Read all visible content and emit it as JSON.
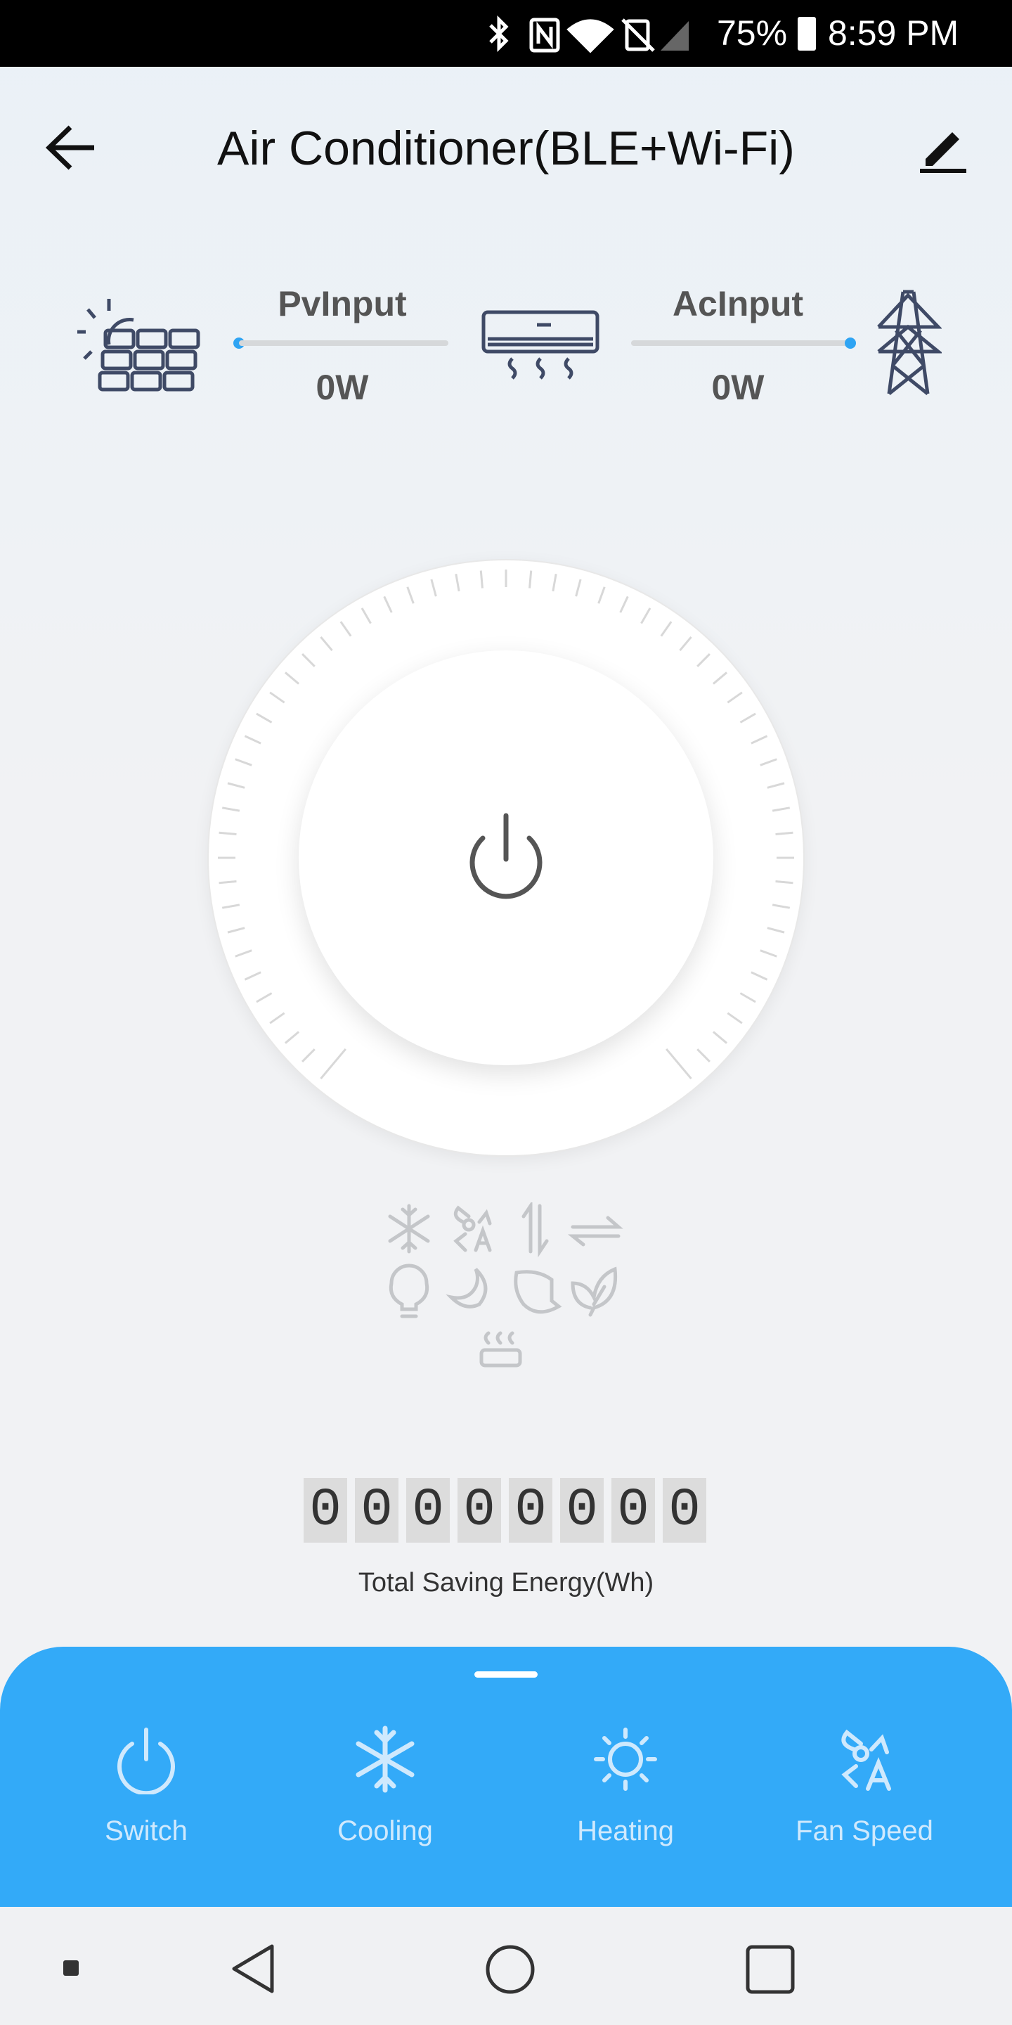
{
  "status_bar": {
    "battery": "75%",
    "time": "8:59 PM",
    "icons": [
      "bluetooth-icon",
      "nfc-icon",
      "wifi-icon",
      "no-sim-icon",
      "signal-icon",
      "battery-icon"
    ]
  },
  "header": {
    "title": "Air Conditioner(BLE+Wi-Fi)",
    "back_icon": "arrow-left-icon",
    "edit_icon": "pencil-icon"
  },
  "energy_flow": {
    "pv_label": "PvInput",
    "pv_value": "0W",
    "ac_label": "AcInput",
    "ac_value": "0W",
    "accent": "#2fa4f3"
  },
  "dial": {
    "power_icon": "power-icon"
  },
  "mode_icons": [
    "snowflake-icon",
    "fan-auto-icon",
    "swing-vertical-icon",
    "swing-horizontal-icon",
    "bulb-icon",
    "moon-icon",
    "leaf-icon",
    "eco-leaf-icon",
    "heater-icon"
  ],
  "counter": {
    "digits": [
      "0",
      "0",
      "0",
      "0",
      "0",
      "0",
      "0",
      "0"
    ],
    "label": "Total Saving Energy(Wh)"
  },
  "bottom_sheet": {
    "color": "#33aaf8",
    "tabs": [
      {
        "label": "Switch",
        "icon": "power-icon"
      },
      {
        "label": "Cooling",
        "icon": "snowflake-icon"
      },
      {
        "label": "Heating",
        "icon": "sun-icon"
      },
      {
        "label": "Fan Speed",
        "icon": "fan-auto-icon"
      }
    ]
  }
}
